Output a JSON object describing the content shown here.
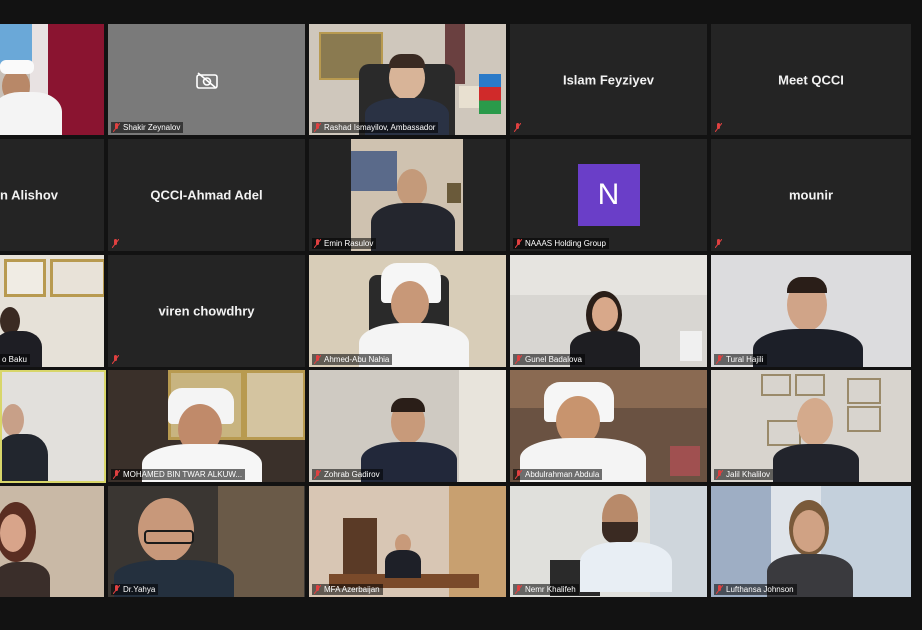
{
  "grid": {
    "tiles": [
      {
        "label": "",
        "kind": "video",
        "muted": false
      },
      {
        "label": "Shakir Zeynalov",
        "kind": "camera-off",
        "muted": true
      },
      {
        "label": "Rashad Ismayilov, Ambassador",
        "kind": "video",
        "muted": true
      },
      {
        "label": "",
        "center": "Islam Feyziyev",
        "kind": "name",
        "muted": true
      },
      {
        "label": "",
        "center": "Meet QCCI",
        "kind": "name",
        "muted": true
      },
      {
        "label": "",
        "center": "n Alishov",
        "kind": "name",
        "muted": false
      },
      {
        "label": "",
        "center": "QCCI-Ahmad Adel",
        "kind": "name",
        "muted": true
      },
      {
        "label": "Emin Rasulov",
        "kind": "video",
        "muted": true
      },
      {
        "label": "NAAAS Holding Group",
        "avatar": "N",
        "kind": "avatar",
        "muted": true
      },
      {
        "label": "",
        "center": "mounir",
        "kind": "name",
        "muted": true
      },
      {
        "label": "o Baku",
        "kind": "video",
        "muted": false
      },
      {
        "label": "",
        "center": "viren chowdhry",
        "kind": "name",
        "muted": true
      },
      {
        "label": "Ahmed-Abu Nahia",
        "kind": "video",
        "muted": true
      },
      {
        "label": "Gunel Badalova",
        "kind": "video",
        "muted": true
      },
      {
        "label": "Tural Hajili",
        "kind": "video",
        "muted": true
      },
      {
        "label": "",
        "kind": "video",
        "muted": false
      },
      {
        "label": "MOHAMED BIN TWAR ALKUW...",
        "kind": "video",
        "muted": true
      },
      {
        "label": "Zohrab Gadirov",
        "kind": "video",
        "muted": true
      },
      {
        "label": "Abdulrahman Abdula",
        "kind": "video",
        "muted": true
      },
      {
        "label": "Jalil Khalilov",
        "kind": "video",
        "muted": true
      },
      {
        "label": "",
        "kind": "video",
        "muted": false
      },
      {
        "label": "Dr.Yahya",
        "kind": "video",
        "muted": true
      },
      {
        "label": "MFA Azerbaijan",
        "kind": "video",
        "muted": true
      },
      {
        "label": "Nemr Khalifeh",
        "kind": "video",
        "muted": true
      },
      {
        "label": "Lufthansa Johnson",
        "kind": "video",
        "muted": true
      }
    ]
  },
  "colors": {
    "background": "#121212",
    "tile": "#232323",
    "active_border": "#d8d66a",
    "avatar": "#6a3ec8",
    "muted_icon": "#e04040"
  }
}
